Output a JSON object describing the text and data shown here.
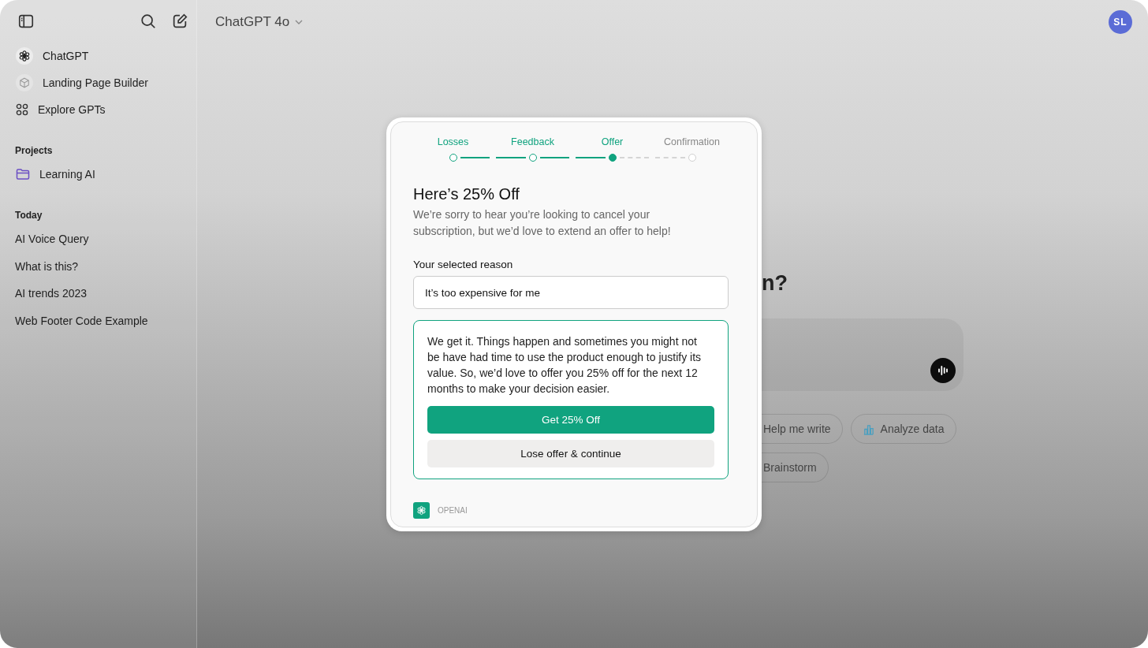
{
  "sidebar": {
    "items": [
      {
        "label": "ChatGPT",
        "kind": "chatgpt"
      },
      {
        "label": "Landing Page Builder",
        "kind": "cube"
      },
      {
        "label": "Explore GPTs",
        "kind": "grid"
      }
    ],
    "projects": {
      "heading": "Projects",
      "items": [
        {
          "label": "Learning AI"
        }
      ]
    },
    "history": {
      "heading": "Today",
      "items": [
        {
          "label": "AI Voice Query"
        },
        {
          "label": "What is this?"
        },
        {
          "label": "AI trends 2023"
        },
        {
          "label": "Web Footer Code Example"
        }
      ]
    }
  },
  "header": {
    "model": "ChatGPT 4o",
    "avatar": "SL"
  },
  "main": {
    "heading": "n?",
    "suggestions": [
      [
        {
          "label": "Help me write",
          "kind": "plain"
        },
        {
          "label": "Analyze data",
          "kind": "chart"
        }
      ],
      [
        {
          "label": "Brainstorm",
          "kind": "plain"
        }
      ]
    ]
  },
  "modal": {
    "steps": [
      {
        "label": "Losses",
        "completed": true,
        "selected": false
      },
      {
        "label": "Feedback",
        "completed": true,
        "selected": false
      },
      {
        "label": "Offer",
        "completed": false,
        "selected": true
      },
      {
        "label": "Confirmation",
        "completed": false,
        "selected": false
      }
    ],
    "title": "Here’s 25% Off",
    "subtitle": "We’re sorry to hear you’re looking to cancel your subscription, but we’d love to extend an offer to help!",
    "reason_label": "Your selected reason",
    "reason_value": "It’s too expensive for me",
    "offer_text": "We get it. Things happen and sometimes you might not be have had time to use the product enough to justify its value. So, we’d love to offer you 25% off for the next 12 months to make your decision easier.",
    "primary_button": "Get 25% Off",
    "secondary_button": "Lose offer & continue",
    "footer": "OPENAI"
  }
}
